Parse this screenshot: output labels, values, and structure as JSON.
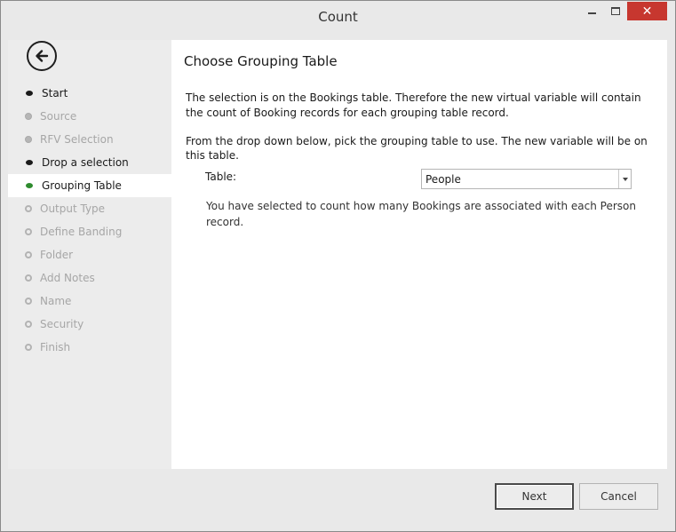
{
  "window": {
    "title": "Count"
  },
  "nav": {
    "back_icon": "back-arrow-circle-icon",
    "steps": [
      {
        "label": "Start",
        "state": "done"
      },
      {
        "label": "Source",
        "state": "skipped"
      },
      {
        "label": "RFV Selection",
        "state": "skipped"
      },
      {
        "label": "Drop a selection",
        "state": "done"
      },
      {
        "label": "Grouping Table",
        "state": "current"
      },
      {
        "label": "Output Type",
        "state": "todo"
      },
      {
        "label": "Define Banding",
        "state": "todo"
      },
      {
        "label": "Folder",
        "state": "todo"
      },
      {
        "label": "Add Notes",
        "state": "todo"
      },
      {
        "label": "Name",
        "state": "todo"
      },
      {
        "label": "Security",
        "state": "todo"
      },
      {
        "label": "Finish",
        "state": "todo"
      }
    ]
  },
  "content": {
    "heading": "Choose Grouping Table",
    "para1": "The selection is on the Bookings table. Therefore the new virtual variable will contain the count of Booking records for each grouping table record.",
    "para2": "From the drop down below, pick the grouping table to use. The new variable will be on this table.",
    "table_label": "Table:",
    "table_value": "People",
    "info": "You have selected to count how many Bookings are associated with each Person record."
  },
  "footer": {
    "next_label": "Next",
    "cancel_label": "Cancel"
  },
  "colors": {
    "current_marker": "#2e8b2e",
    "close_button": "#c7372f"
  }
}
